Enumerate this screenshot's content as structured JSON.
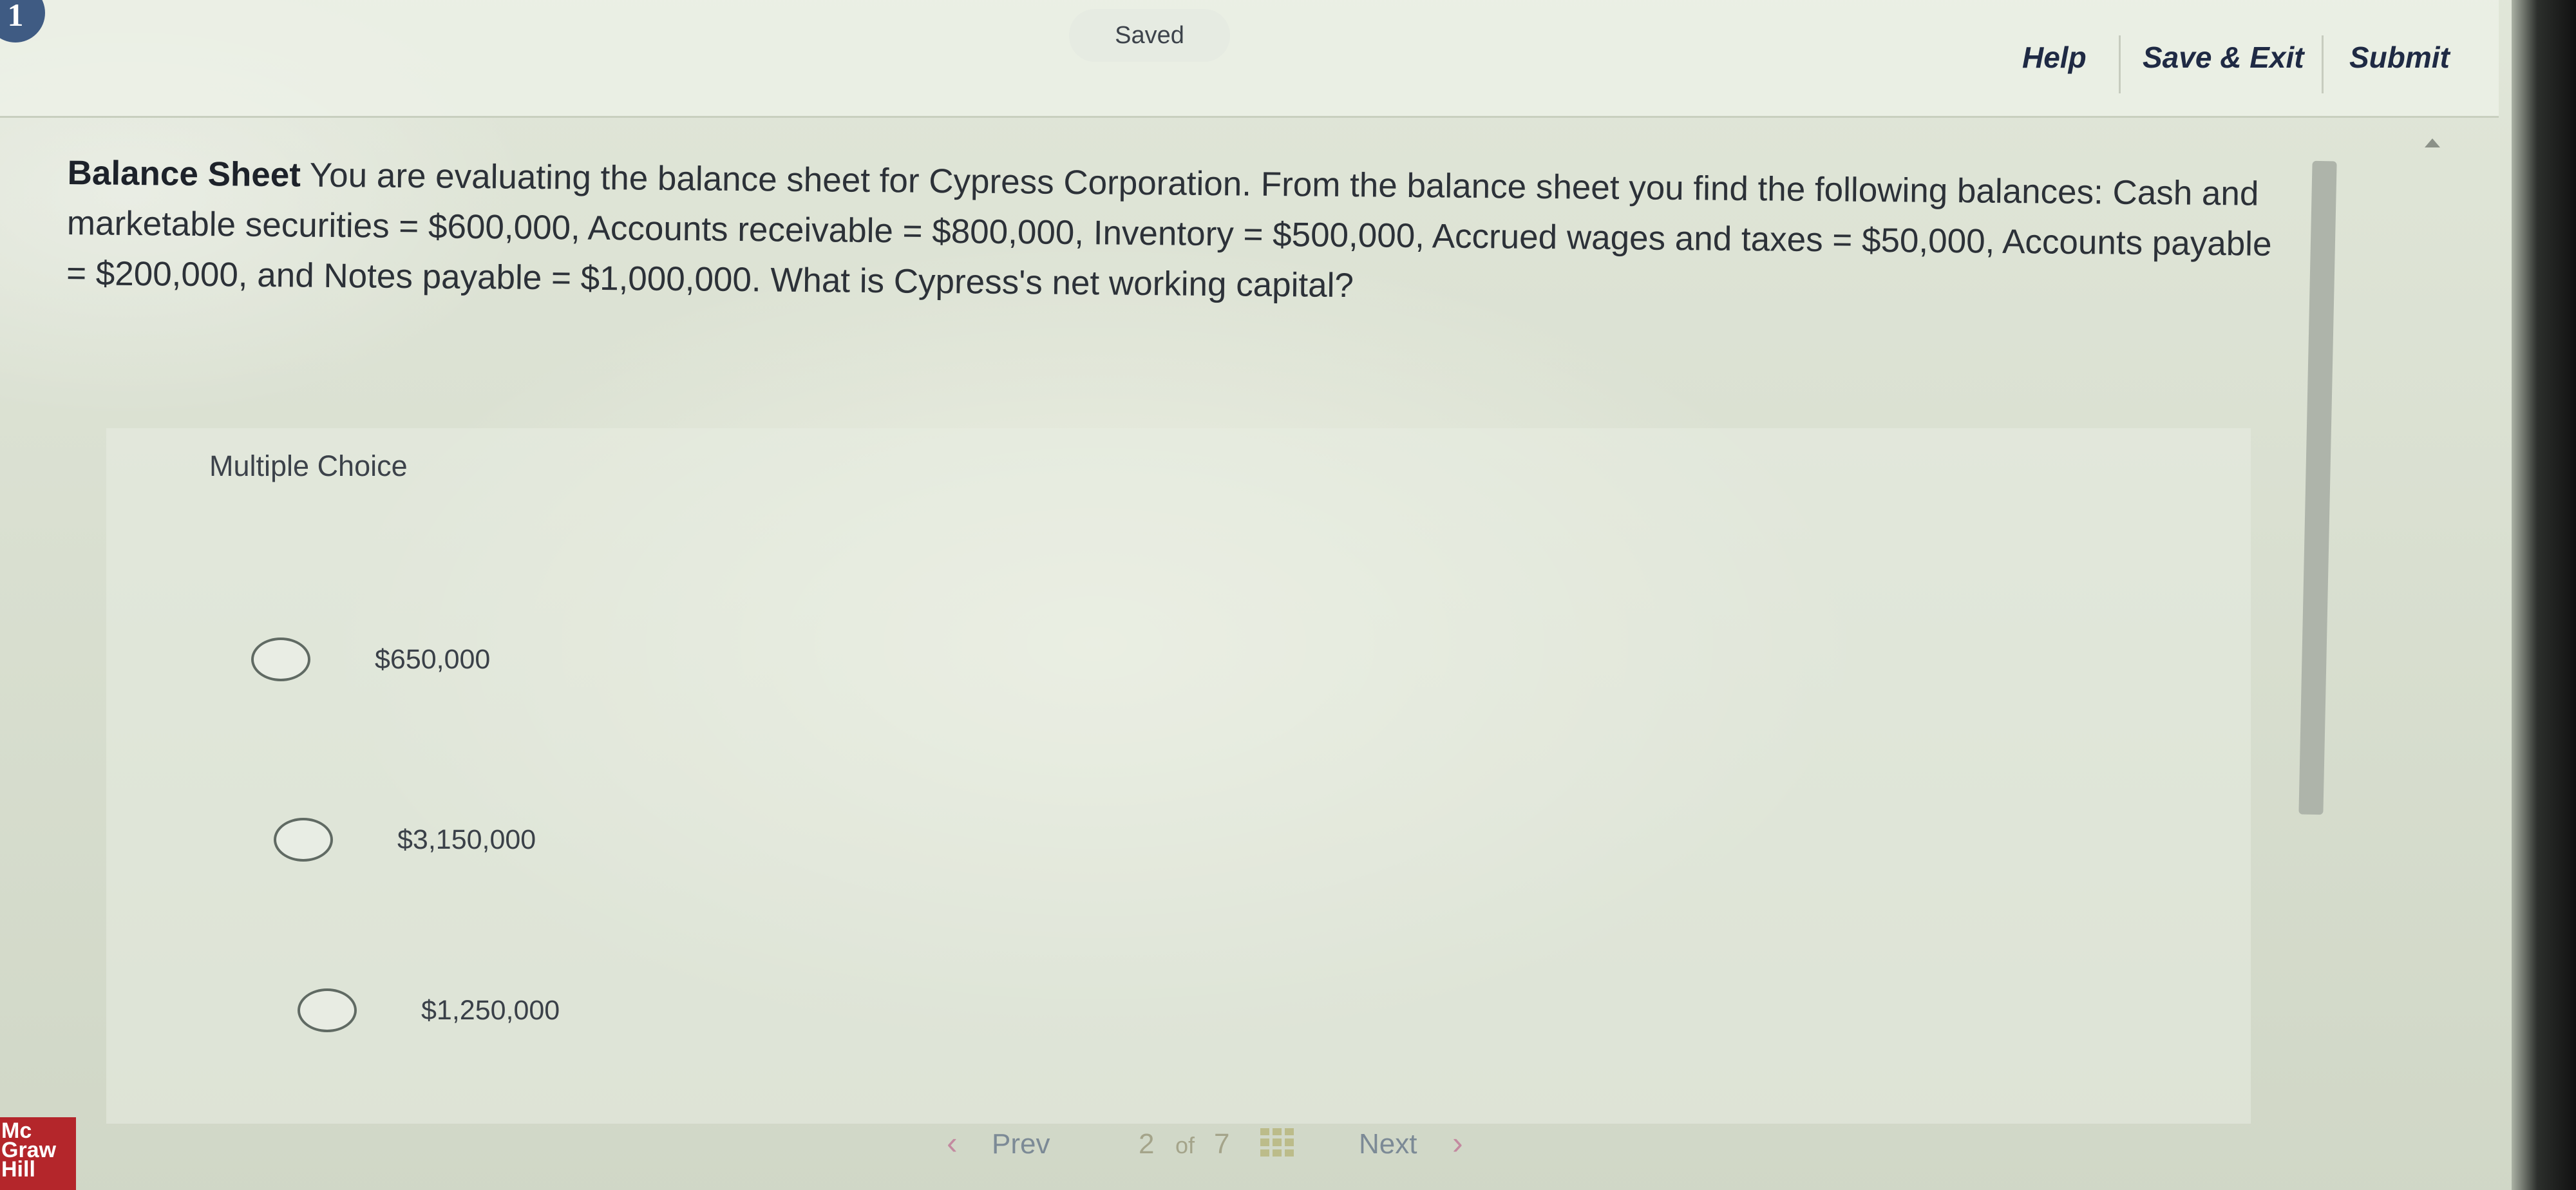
{
  "header": {
    "question_number": "1",
    "saved_label": "Saved",
    "help_label": "Help",
    "save_exit_label": "Save & Exit",
    "submit_label": "Submit"
  },
  "question": {
    "title": "Balance Sheet",
    "body": "You are evaluating the balance sheet for Cypress Corporation. From the balance sheet you find the following balances: Cash and marketable securities = $600,000, Accounts receivable = $800,000, Inventory = $500,000, Accrued wages and taxes = $50,000, Accounts payable = $200,000, and Notes payable = $1,000,000. What is Cypress's net working capital?"
  },
  "choices": {
    "label": "Multiple Choice",
    "options": [
      {
        "text": "$650,000"
      },
      {
        "text": "$3,150,000"
      },
      {
        "text": "$1,250,000"
      }
    ]
  },
  "footer": {
    "logo_lines": [
      "Mc",
      "Graw",
      "Hill"
    ],
    "prev_label": "Prev",
    "page_current": "2",
    "page_of": "of",
    "page_total": "7",
    "next_label": "Next"
  },
  "colors": {
    "logo_red": "#b4262b",
    "question_badge": "#3f5b83"
  }
}
